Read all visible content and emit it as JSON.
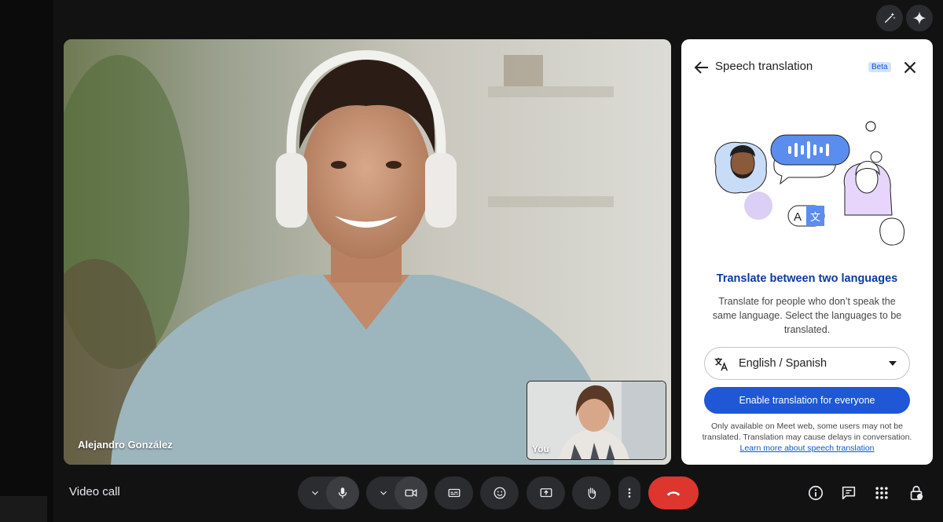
{
  "meeting": {
    "title": "Video call"
  },
  "main_tile": {
    "participant_name": "Alejandro González"
  },
  "self_tile": {
    "label": "You"
  },
  "top_actions": {
    "icons": [
      "magic-wand-icon",
      "sparkle-icon"
    ]
  },
  "panel": {
    "title": "Speech translation",
    "badge": "Beta",
    "heading": "Translate between two languages",
    "description": "Translate for people who don’t speak the same language. Select the languages to be translated.",
    "language_select": {
      "value": "English / Spanish"
    },
    "enable_button": "Enable translation for everyone",
    "footnote": "Only available on Meet web, some users may not be translated. Translation may cause delays in conversation.",
    "learn_more_link": "Learn more about speech translation"
  },
  "controls": {
    "icons": [
      "chevron-down-icon",
      "microphone-icon",
      "chevron-down-icon",
      "camera-icon",
      "captions-icon",
      "emoji-icon",
      "present-icon",
      "raise-hand-icon",
      "more-icon",
      "end-call-icon"
    ]
  },
  "right_controls": {
    "icons": [
      "info-icon",
      "chat-icon",
      "apps-icon",
      "host-controls-icon"
    ]
  },
  "colors": {
    "end_call": "#dc362e",
    "primary_button": "#1f57d6",
    "heading": "#0b3a9f",
    "badge_bg": "#d3e3fd"
  }
}
